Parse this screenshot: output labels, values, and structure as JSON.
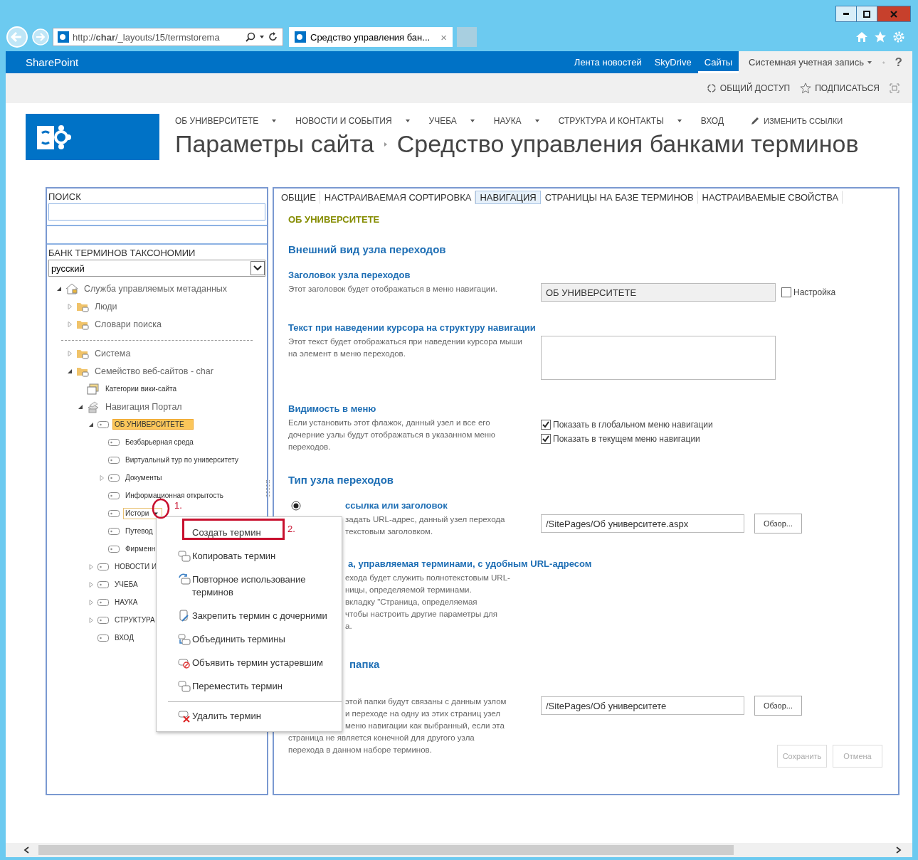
{
  "browser": {
    "address": "http://**char**/_layouts/15/termstorema",
    "tab_title": "Средство управления бан...",
    "tab_close": "×"
  },
  "suite_bar": {
    "brand": "SharePoint",
    "links": [
      {
        "label": "Лента новостей",
        "selected": false
      },
      {
        "label": "SkyDrive",
        "selected": false
      },
      {
        "label": "Сайты",
        "selected": true
      }
    ],
    "user": "Системная учетная запись",
    "help": "?"
  },
  "actions": [
    {
      "label": "ОБЩИЙ ДОСТУП",
      "kind": "share"
    },
    {
      "label": "ПОДПИСАТЬСЯ",
      "kind": "follow"
    }
  ],
  "top_nav": [
    {
      "label": "ОБ УНИВЕРСИТЕТЕ",
      "has_menu": true
    },
    {
      "label": "НОВОСТИ И СОБЫТИЯ",
      "has_menu": true
    },
    {
      "label": "УЧЕБА",
      "has_menu": true
    },
    {
      "label": "НАУКА",
      "has_menu": true
    },
    {
      "label": "СТРУКТУРА И КОНТАКТЫ",
      "has_menu": true
    },
    {
      "label": "ВХОД",
      "has_menu": false
    }
  ],
  "edit_links": "ИЗМЕНИТЬ ССЫЛКИ",
  "breadcrumb": [
    "Параметры сайта",
    "Средство управления банками терминов"
  ],
  "left_panel": {
    "search_label": "ПОИСК",
    "store_label": "БАНК ТЕРМИНОВ ТАКСОНОМИИ",
    "language": "русский",
    "tree": [
      {
        "label": "Служба управляемых метаданных",
        "kind": "service",
        "expanded": true,
        "selected": false,
        "children": [
          {
            "label": "Люди",
            "kind": "group",
            "expanded": false,
            "selected": false
          },
          {
            "label": "Словари поиска",
            "kind": "group",
            "expanded": false,
            "selected": false
          },
          {
            "kind": "separator"
          },
          {
            "label": "Система",
            "kind": "group",
            "expanded": false,
            "selected": false
          },
          {
            "label": "Семейство веб-сайтов - char",
            "kind": "group",
            "expanded": true,
            "selected": false,
            "children": [
              {
                "label": "Категории вики-сайта",
                "kind": "wiki",
                "selected": false
              },
              {
                "label": "Навигация Портал",
                "kind": "navset",
                "expanded": true,
                "selected": false,
                "children": [
                  {
                    "label": "ОБ УНИВЕРСИТЕТЕ",
                    "kind": "term",
                    "expanded": true,
                    "selected": true,
                    "children": [
                      {
                        "label": "Безбарьерная среда",
                        "kind": "term",
                        "selected": false
                      },
                      {
                        "label": "Виртуальный тур по университету",
                        "kind": "term",
                        "selected": false
                      },
                      {
                        "label": "Документы",
                        "kind": "term",
                        "expanded": false,
                        "selected": false
                      },
                      {
                        "label": "Информационная открытость",
                        "kind": "term",
                        "selected": false
                      },
                      {
                        "label": "Истори",
                        "kind": "term",
                        "selected": false,
                        "menu_open": true
                      },
                      {
                        "label": "Путевод",
                        "kind": "term",
                        "selected": false
                      },
                      {
                        "label": "Фирменн",
                        "kind": "term",
                        "selected": false
                      }
                    ]
                  },
                  {
                    "label": "НОВОСТИ И",
                    "kind": "term",
                    "expanded": false,
                    "selected": false
                  },
                  {
                    "label": "УЧЕБА",
                    "kind": "term",
                    "expanded": false,
                    "selected": false
                  },
                  {
                    "label": "НАУКА",
                    "kind": "term",
                    "expanded": false,
                    "selected": false
                  },
                  {
                    "label": "СТРУКТУРА",
                    "kind": "term",
                    "expanded": false,
                    "selected": false
                  },
                  {
                    "label": "ВХОД",
                    "kind": "term",
                    "selected": false
                  }
                ]
              }
            ]
          }
        ]
      }
    ]
  },
  "tabs": [
    {
      "label": "ОБЩИЕ",
      "selected": false
    },
    {
      "label": "НАСТРАИВАЕМАЯ СОРТИРОВКА",
      "selected": false
    },
    {
      "label": "НАВИГАЦИЯ",
      "selected": true
    },
    {
      "label": "СТРАНИЦЫ НА БАЗЕ ТЕРМИНОВ",
      "selected": false
    },
    {
      "label": "НАСТРАИВАЕМЫЕ СВОЙСТВА",
      "selected": false
    }
  ],
  "term_name": "ОБ УНИВЕРСИТЕТЕ",
  "form": [
    {
      "kind": "heading",
      "text": "Внешний вид узла переходов"
    },
    {
      "kind": "field",
      "title": "Заголовок узла переходов",
      "description": [
        {
          "text": "Этот заголовок будет отображаться в меню навигации."
        }
      ],
      "control": {
        "kind": "text",
        "value": "ОБ УНИВЕРСИТЕТЕ",
        "disabled": true,
        "option": {
          "label": "Настройка",
          "checked": false
        }
      }
    },
    {
      "kind": "field",
      "title": "Текст при наведении курсора на структуру навигации",
      "description": [
        {
          "text": "Этот текст будет отображаться при наведении курсора мыши на элемент в меню переходов."
        }
      ],
      "control": {
        "kind": "textarea"
      }
    },
    {
      "kind": "field",
      "title": "Видимость в меню",
      "description": [
        {
          "text": "Если установить этот флажок, данный узел и все его дочерние узлы будут отображаться в указанном меню переходов."
        }
      ],
      "control": {
        "kind": "checks",
        "items": [
          {
            "label": "Показать в глобальном меню навигации",
            "checked": true
          },
          {
            "label": "Показать в текущем меню навигации",
            "checked": true
          }
        ]
      }
    },
    {
      "kind": "heading",
      "text": "Тип узла переходов"
    },
    {
      "kind": "field",
      "title": "ссылка или заголовок",
      "clipped": true,
      "radio": {
        "selected": true
      },
      "description": [
        {
          "text": "задать URL-адрес, данный узел перехода",
          "clipped": true
        },
        {
          "text": "текстовым заголовком.",
          "clipped": true
        }
      ],
      "control": {
        "kind": "browse",
        "value": "/SitePages/Об университете.aspx",
        "button": "Обзор..."
      }
    },
    {
      "kind": "field",
      "title": "а, управляемая терминами, с удобным URL-адресом",
      "clipped": true,
      "description": [
        {
          "text": "ехода будет служить полнотекстовым URL-",
          "clipped": true
        },
        {
          "text": "ницы, определяемой терминами.",
          "clipped": true
        },
        {
          "text": "вкладку \"Страница, определяемая",
          "clipped": true
        },
        {
          "text": "чтобы настроить другие параметры для",
          "clipped": true
        },
        {
          "text": "а.",
          "clipped": true
        }
      ]
    },
    {
      "kind": "heading",
      "text": "папка",
      "clipped": true
    },
    {
      "kind": "field",
      "description": [
        {
          "text": "этой папки будут связаны с данным узлом",
          "clipped": true
        },
        {
          "text": "и переходе на одну из этих страниц узел",
          "clipped": true
        },
        {
          "text": "меню навигации как выбранный, если эта",
          "clipped": true
        },
        {
          "text": "страница не является конечной для другого узла"
        },
        {
          "text": "перехода в данном наборе терминов."
        }
      ],
      "control": {
        "kind": "browse",
        "value": "/SitePages/Об университете",
        "button": "Обзор..."
      }
    }
  ],
  "buttons": [
    {
      "label": "Сохранить",
      "disabled": true
    },
    {
      "label": "Отмена",
      "disabled": true
    }
  ],
  "context_menu": {
    "items": [
      {
        "label": "Создать термин",
        "kind": "create",
        "divider_before": false
      },
      {
        "label": "Копировать термин",
        "kind": "copy",
        "divider_before": false
      },
      {
        "label": "Повторное использование терминов",
        "kind": "reuse",
        "divider_before": false
      },
      {
        "label": "Закрепить термин с дочерними",
        "kind": "pin",
        "divider_before": false
      },
      {
        "label": "Объединить термины",
        "kind": "merge",
        "divider_before": false
      },
      {
        "label": "Объявить термин устаревшим",
        "kind": "deprecate",
        "divider_before": false
      },
      {
        "label": "Переместить термин",
        "kind": "move",
        "divider_before": false
      },
      {
        "label": "Удалить термин",
        "kind": "delete",
        "divider_before": true
      }
    ]
  },
  "annotations": [
    {
      "label": "1."
    },
    {
      "label": "2."
    }
  ]
}
